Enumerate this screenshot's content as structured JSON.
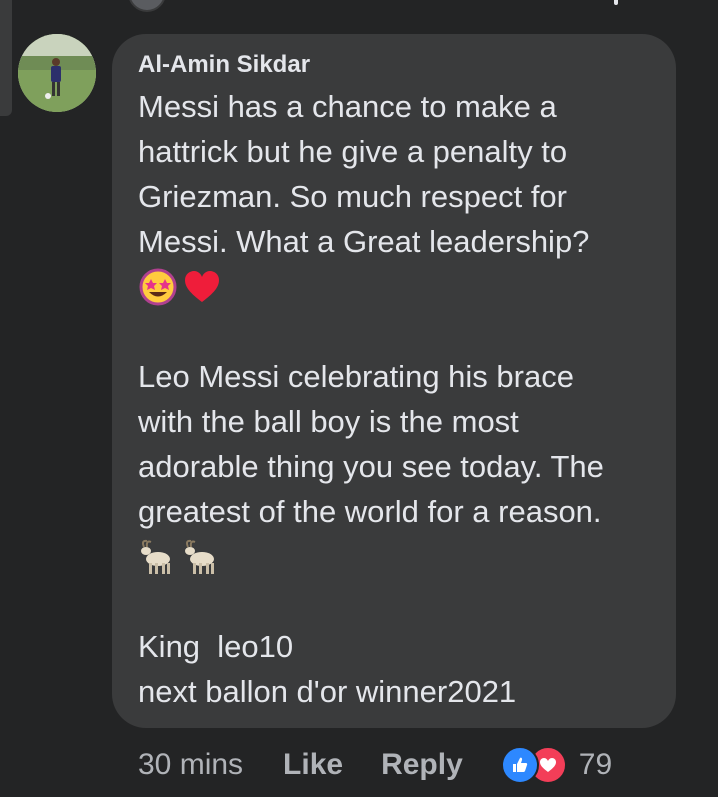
{
  "comment": {
    "author": "Al-Amin Sikdar",
    "lines": [
      "Messi has a chance to make a",
      "hattrick but he give a penalty to",
      "Griezman. So much respect for",
      "Messi. What a Great leadership?"
    ],
    "emoji_row_1": [
      "star-struck-emoji",
      "red-heart-emoji"
    ],
    "lines_2": [
      "Leo Messi celebrating his brace",
      "with the ball boy is the most",
      "adorable thing you see today. The",
      "greatest of the world for a reason."
    ],
    "emoji_row_2": [
      "goat-emoji",
      "goat-emoji"
    ],
    "lines_3": [
      "King  leo10",
      "next ballon d'or winner2021"
    ]
  },
  "actions": {
    "time": "30 mins",
    "like_label": "Like",
    "reply_label": "Reply",
    "reaction_icons": [
      "like-icon",
      "love-icon"
    ],
    "reaction_count": "79"
  },
  "colors": {
    "background": "#232425",
    "bubble": "#3a3b3c",
    "text": "#e4e6eb",
    "secondary_text": "#b0b3b8",
    "like_blue": "#2d88ff",
    "love_red": "#f33e58"
  }
}
